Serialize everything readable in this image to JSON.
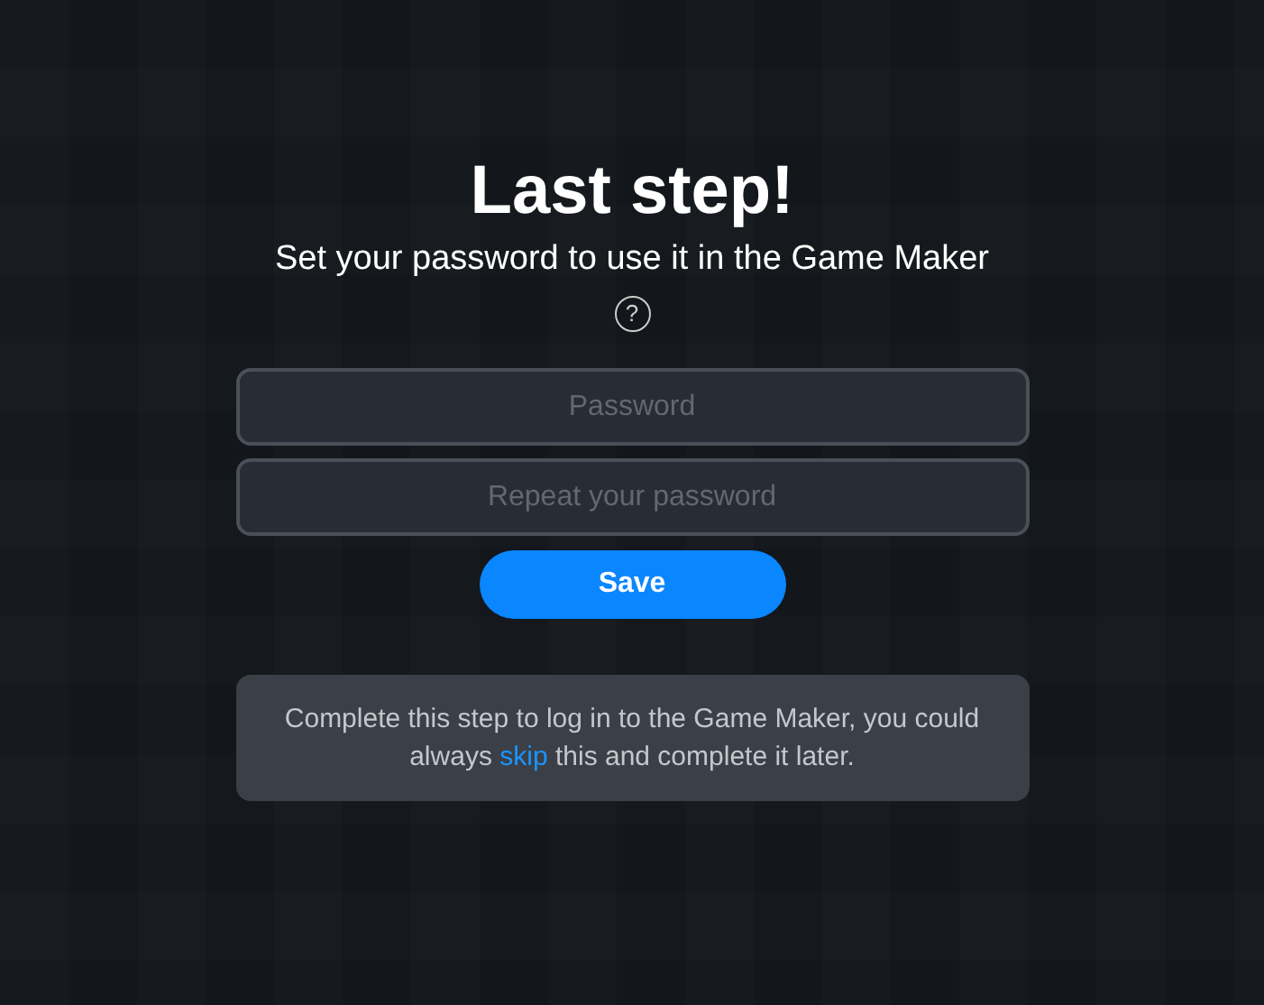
{
  "title": "Last step!",
  "subtitle": "Set your password to use it in the Game Maker",
  "help_icon": "?",
  "fields": [
    {
      "placeholder": "Password"
    },
    {
      "placeholder": "Repeat your password"
    }
  ],
  "save_button": "Save",
  "note": {
    "before": "Complete this step to log in to the Game Maker, you could always ",
    "link": "skip",
    "after": " this and complete it later."
  }
}
